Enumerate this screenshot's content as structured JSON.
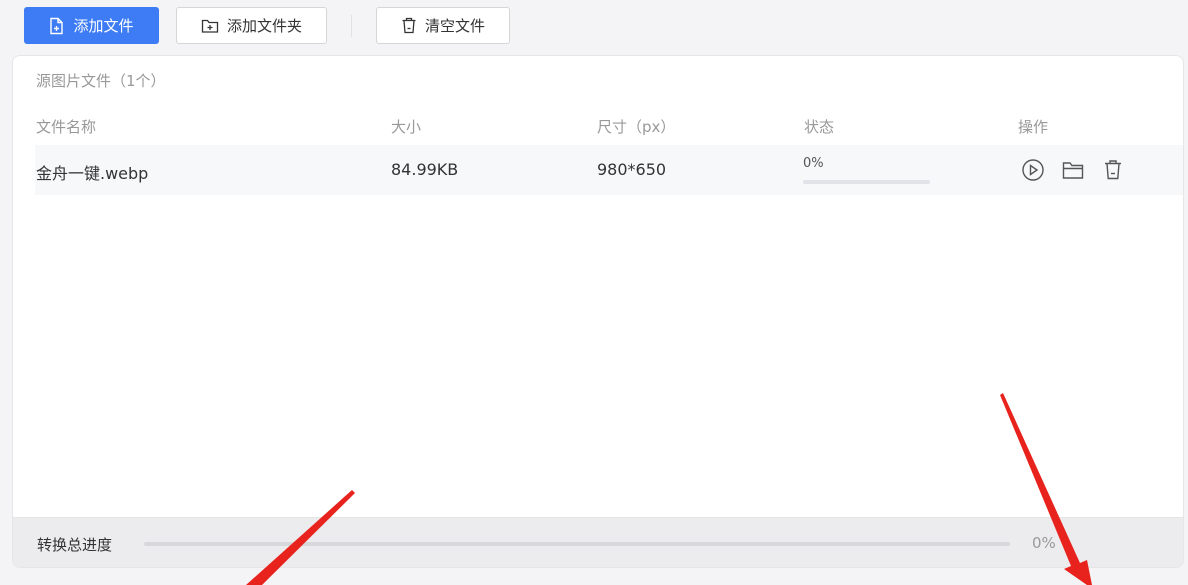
{
  "toolbar": {
    "add_file_label": "添加文件",
    "add_folder_label": "添加文件夹",
    "clear_label": "清空文件"
  },
  "panel": {
    "title": "源图片文件（1个）",
    "columns": {
      "name": "文件名称",
      "size": "大小",
      "dimensions": "尺寸（px）",
      "status": "状态",
      "actions": "操作"
    },
    "rows": [
      {
        "name": "金舟一键.webp",
        "size": "84.99KB",
        "dimensions": "980*650",
        "status": "0%",
        "progress": 0,
        "action_icons": [
          "play-circle-icon",
          "folder-icon",
          "trash-icon"
        ]
      }
    ]
  },
  "footer": {
    "label": "转换总进度",
    "percent_text": "0%",
    "progress": 0
  },
  "colors": {
    "primary": "#3d7cf4",
    "annotation_arrow": "#e8231d"
  }
}
